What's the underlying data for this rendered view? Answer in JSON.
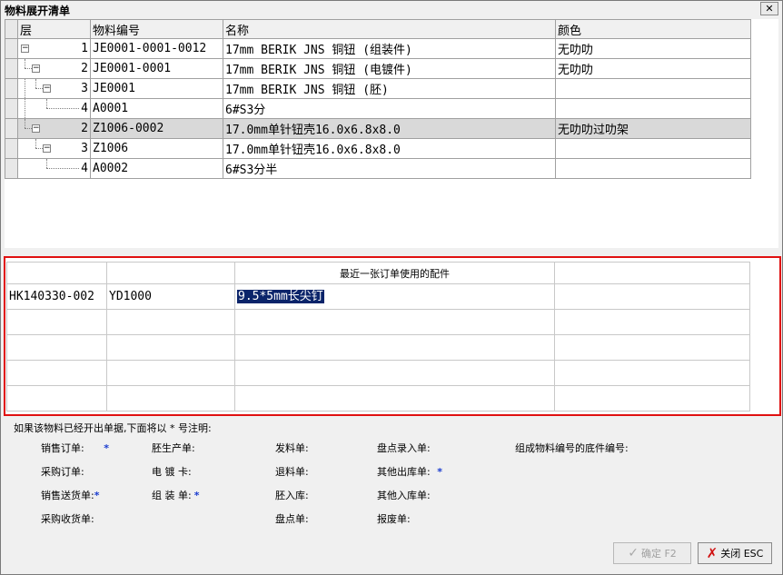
{
  "window": {
    "title": "物料展开清单",
    "close_glyph": "✕"
  },
  "tree": {
    "headers": [
      "层",
      "物料编号",
      "名称",
      "颜色"
    ],
    "rows": [
      {
        "level": "1",
        "code": "JE0001-0001-0012",
        "name": "17mm BERIK JNS 铜钮 (组装件)",
        "color": "无叻叻"
      },
      {
        "level": "2",
        "code": "JE0001-0001",
        "name": "17mm BERIK JNS 铜钮 (电镀件)",
        "color": "无叻叻"
      },
      {
        "level": "3",
        "code": "JE0001",
        "name": "17mm BERIK JNS 铜钮 (胚)",
        "color": ""
      },
      {
        "level": "4",
        "code": "A0001",
        "name": "6#S3分",
        "color": ""
      },
      {
        "level": "2",
        "code": "Z1006-0002",
        "name": "17.0mm单针钮壳16.0x6.8x8.0",
        "color": "无叻叻过叻架"
      },
      {
        "level": "3",
        "code": "Z1006",
        "name": "17.0mm单针钮壳16.0x6.8x8.0",
        "color": ""
      },
      {
        "level": "4",
        "code": "A0002",
        "name": "6#S3分半",
        "color": ""
      }
    ]
  },
  "lower": {
    "headers": [
      "",
      "",
      "最近一张订单使用的配件",
      ""
    ],
    "rows": [
      [
        "HK140330-002",
        "YD1000",
        "9.5*5mm长尖钉",
        ""
      ]
    ]
  },
  "legend": {
    "note": "如果该物料已经开出单据,下面将以 * 号注明:",
    "star": "*",
    "items": {
      "sales_order": "销售订单:",
      "blank_production": "胚生产单:",
      "issue": "发料单:",
      "stocktake_entry": "盘点录入单:",
      "component_code": "组成物料编号的底件编号:",
      "purchase_order": "采购订单:",
      "plating_card": "电 镀 卡:",
      "return": "退料单:",
      "other_out": "其他出库单:",
      "sales_delivery": "销售送货单:",
      "assembly": "组 装 单:",
      "blank_in": "胚入库:",
      "other_in": "其他入库单:",
      "purchase_receipt": "采购收货单:",
      "stocktake": "盘点单:",
      "scrap": "报废单:"
    }
  },
  "buttons": {
    "confirm": "确定 F2",
    "close": "关闭 ESC"
  }
}
